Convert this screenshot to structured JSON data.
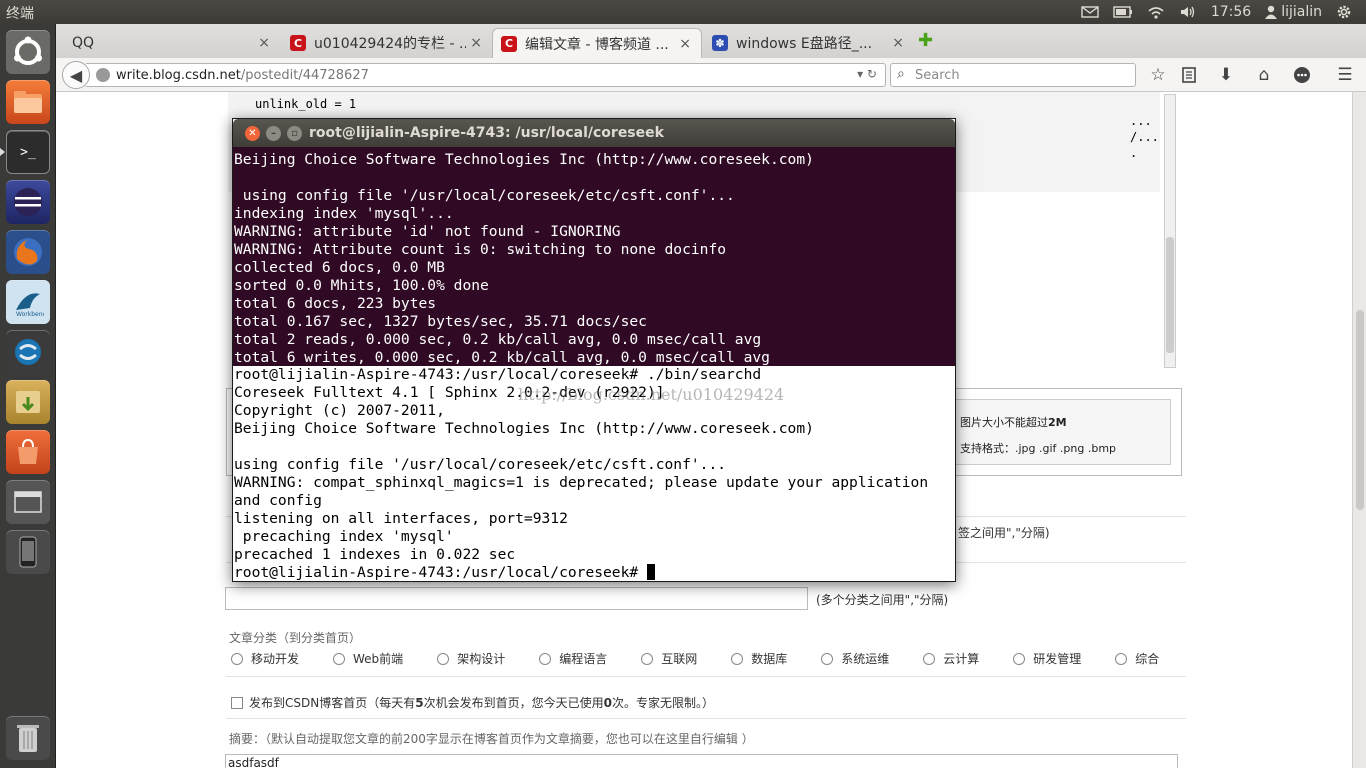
{
  "topbar": {
    "title": "终端",
    "time": "17:56",
    "user": "lijialin"
  },
  "launcher": {
    "items": [
      "ubuntu-logo-icon",
      "files-icon",
      "terminal-icon",
      "eclipse-icon",
      "firefox-icon",
      "mysql-workbench-icon",
      "sublime-icon",
      "archive-manager-icon",
      "software-center-icon",
      "workspace-switcher-icon",
      "phone-icon",
      "trash-icon"
    ]
  },
  "tabs": [
    {
      "label": "QQ",
      "close": "×"
    },
    {
      "label": "u010429424的专栏 - ...",
      "close": "×"
    },
    {
      "label": "编辑文章 - 博客频道 ...",
      "close": "×"
    },
    {
      "label": "windows E盘路径_...",
      "close": "×"
    }
  ],
  "newtab": "✚",
  "nav": {
    "url_domain": "write.blog.csdn.net",
    "url_path": "/postedit/44728627",
    "search_placeholder": "Search"
  },
  "page": {
    "code_lines": [
      "unlink_old        = 1"
    ],
    "code_right": [
      "...",
      "/...",
      "."
    ],
    "upload_size": "图片大小不能超过",
    "upload_size_val": "2M",
    "upload_formats": "支持格式：.jpg .gif .png .bmp",
    "tag_hint": "签之间用\",\"分隔)",
    "category_hint": "(多个分类之间用\",\"分隔)",
    "category_title": "文章分类（到分类首页）",
    "categories": [
      "移动开发",
      "Web前端",
      "架构设计",
      "编程语言",
      "互联网",
      "数据库",
      "系统运维",
      "云计算",
      "研发管理",
      "综合"
    ],
    "publish_pre": "发布到CSDN博客首页（每天有",
    "publish_n1": "5",
    "publish_mid": "次机会发布到首页，您今天已使用",
    "publish_n2": "0",
    "publish_post": "次。专家无限制。）",
    "summary_label": "摘要：（默认自动提取您文章的前200字显示在博客首页作为文章摘要，您也可以在这里自行编辑 ）",
    "summary_value": "asdfasdf"
  },
  "terminal": {
    "title": "root@lijialin-Aspire-4743: /usr/local/coreseek",
    "upper_lines": [
      "Beijing Choice Software Technologies Inc (http://www.coreseek.com)",
      "",
      " using config file '/usr/local/coreseek/etc/csft.conf'...",
      "indexing index 'mysql'...",
      "WARNING: attribute 'id' not found - IGNORING",
      "WARNING: Attribute count is 0: switching to none docinfo",
      "collected 6 docs, 0.0 MB",
      "sorted 0.0 Mhits, 100.0% done",
      "total 6 docs, 223 bytes",
      "total 0.167 sec, 1327 bytes/sec, 35.71 docs/sec",
      "total 2 reads, 0.000 sec, 0.2 kb/call avg, 0.0 msec/call avg",
      "total 6 writes, 0.000 sec, 0.2 kb/call avg, 0.0 msec/call avg"
    ],
    "lower_lines": [
      "root@lijialin-Aspire-4743:/usr/local/coreseek# ./bin/searchd",
      "Coreseek Fulltext 4.1 [ Sphinx 2.0.2-dev (r2922)]",
      "Copyright (c) 2007-2011,",
      "Beijing Choice Software Technologies Inc (http://www.coreseek.com)",
      "",
      "using config file '/usr/local/coreseek/etc/csft.conf'...",
      "WARNING: compat_sphinxql_magics=1 is deprecated; please update your application",
      "and config",
      "listening on all interfaces, port=9312",
      " precaching index 'mysql'",
      "precached 1 indexes in 0.022 sec"
    ],
    "prompt": "root@lijialin-Aspire-4743:/usr/local/coreseek# ",
    "watermark": "http://blog.csdn.net/u010429424"
  }
}
